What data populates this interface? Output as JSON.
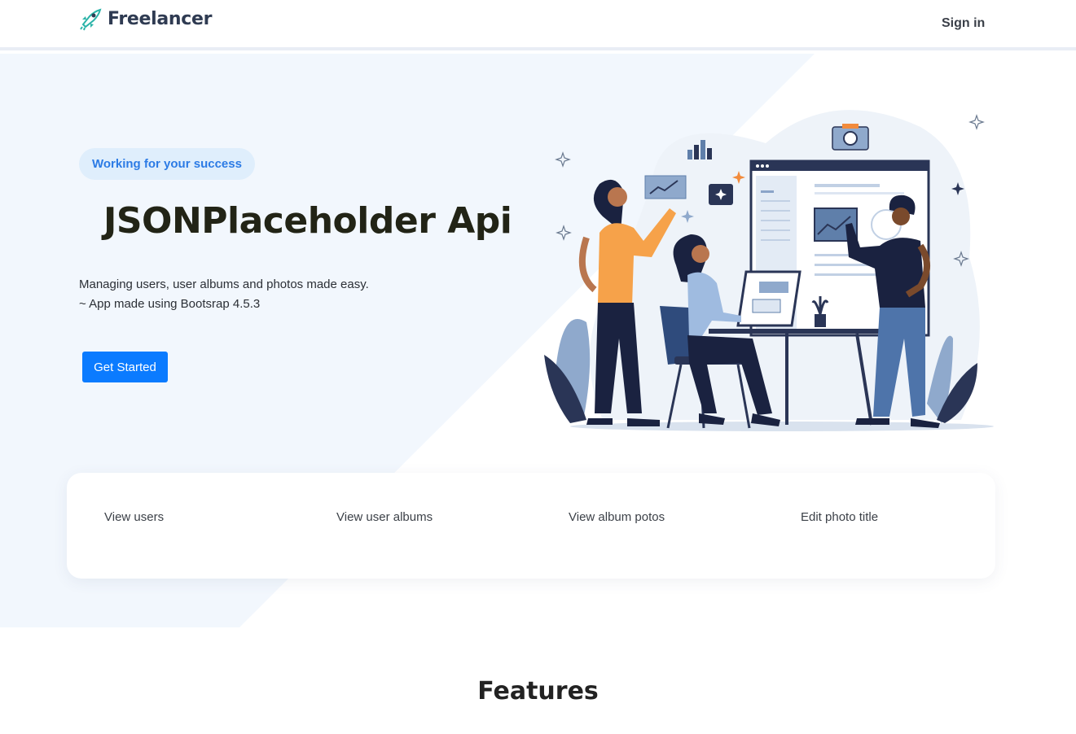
{
  "navbar": {
    "brand": "Freelancer",
    "signin_label": "Sign in"
  },
  "hero": {
    "badge": "Working for your success",
    "title": "JSONPlaceholder Api",
    "subtitle_line1": "Managing users, user albums and photos made easy.",
    "subtitle_line2": "~ App made using Bootsrap 4.5.3",
    "cta_label": "Get Started"
  },
  "features": {
    "items": [
      {
        "label": "View users"
      },
      {
        "label": "View user albums"
      },
      {
        "label": "View album potos"
      },
      {
        "label": "Edit photo title"
      }
    ],
    "section_title": "Features"
  },
  "colors": {
    "accent": "#0b7bff",
    "badge_bg": "#dfeefc",
    "badge_text": "#2c7be5",
    "hero_bg": "#f2f7fd",
    "brand_teal": "#2bb3a8"
  },
  "icons": {
    "brand_logo": "rocket-icon"
  }
}
